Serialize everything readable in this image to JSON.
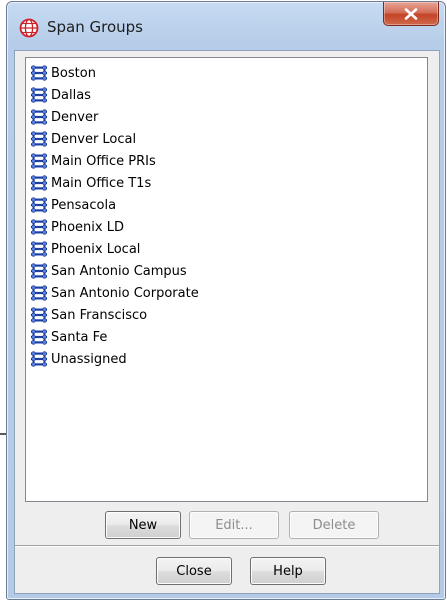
{
  "window": {
    "title": "Span Groups",
    "close_glyph": "X",
    "app_icon": "globe-icon"
  },
  "list": {
    "item_icon": "network-group-icon",
    "items": [
      {
        "label": "Boston"
      },
      {
        "label": "Dallas"
      },
      {
        "label": "Denver"
      },
      {
        "label": "Denver Local"
      },
      {
        "label": "Main Office PRIs"
      },
      {
        "label": "Main Office T1s"
      },
      {
        "label": "Pensacola"
      },
      {
        "label": "Phoenix LD"
      },
      {
        "label": "Phoenix Local"
      },
      {
        "label": "San Antonio Campus"
      },
      {
        "label": "San Antonio Corporate"
      },
      {
        "label": "San Franscisco"
      },
      {
        "label": "Santa Fe"
      },
      {
        "label": "Unassigned"
      }
    ]
  },
  "actions": {
    "new_label": "New",
    "edit_label": "Edit...",
    "delete_label": "Delete"
  },
  "footer": {
    "close_label": "Close",
    "help_label": "Help"
  },
  "colors": {
    "frame": "#b6cde9",
    "close_button": "#c54327",
    "icon_blue": "#1b3fa8",
    "app_icon_red": "#d0202a"
  }
}
